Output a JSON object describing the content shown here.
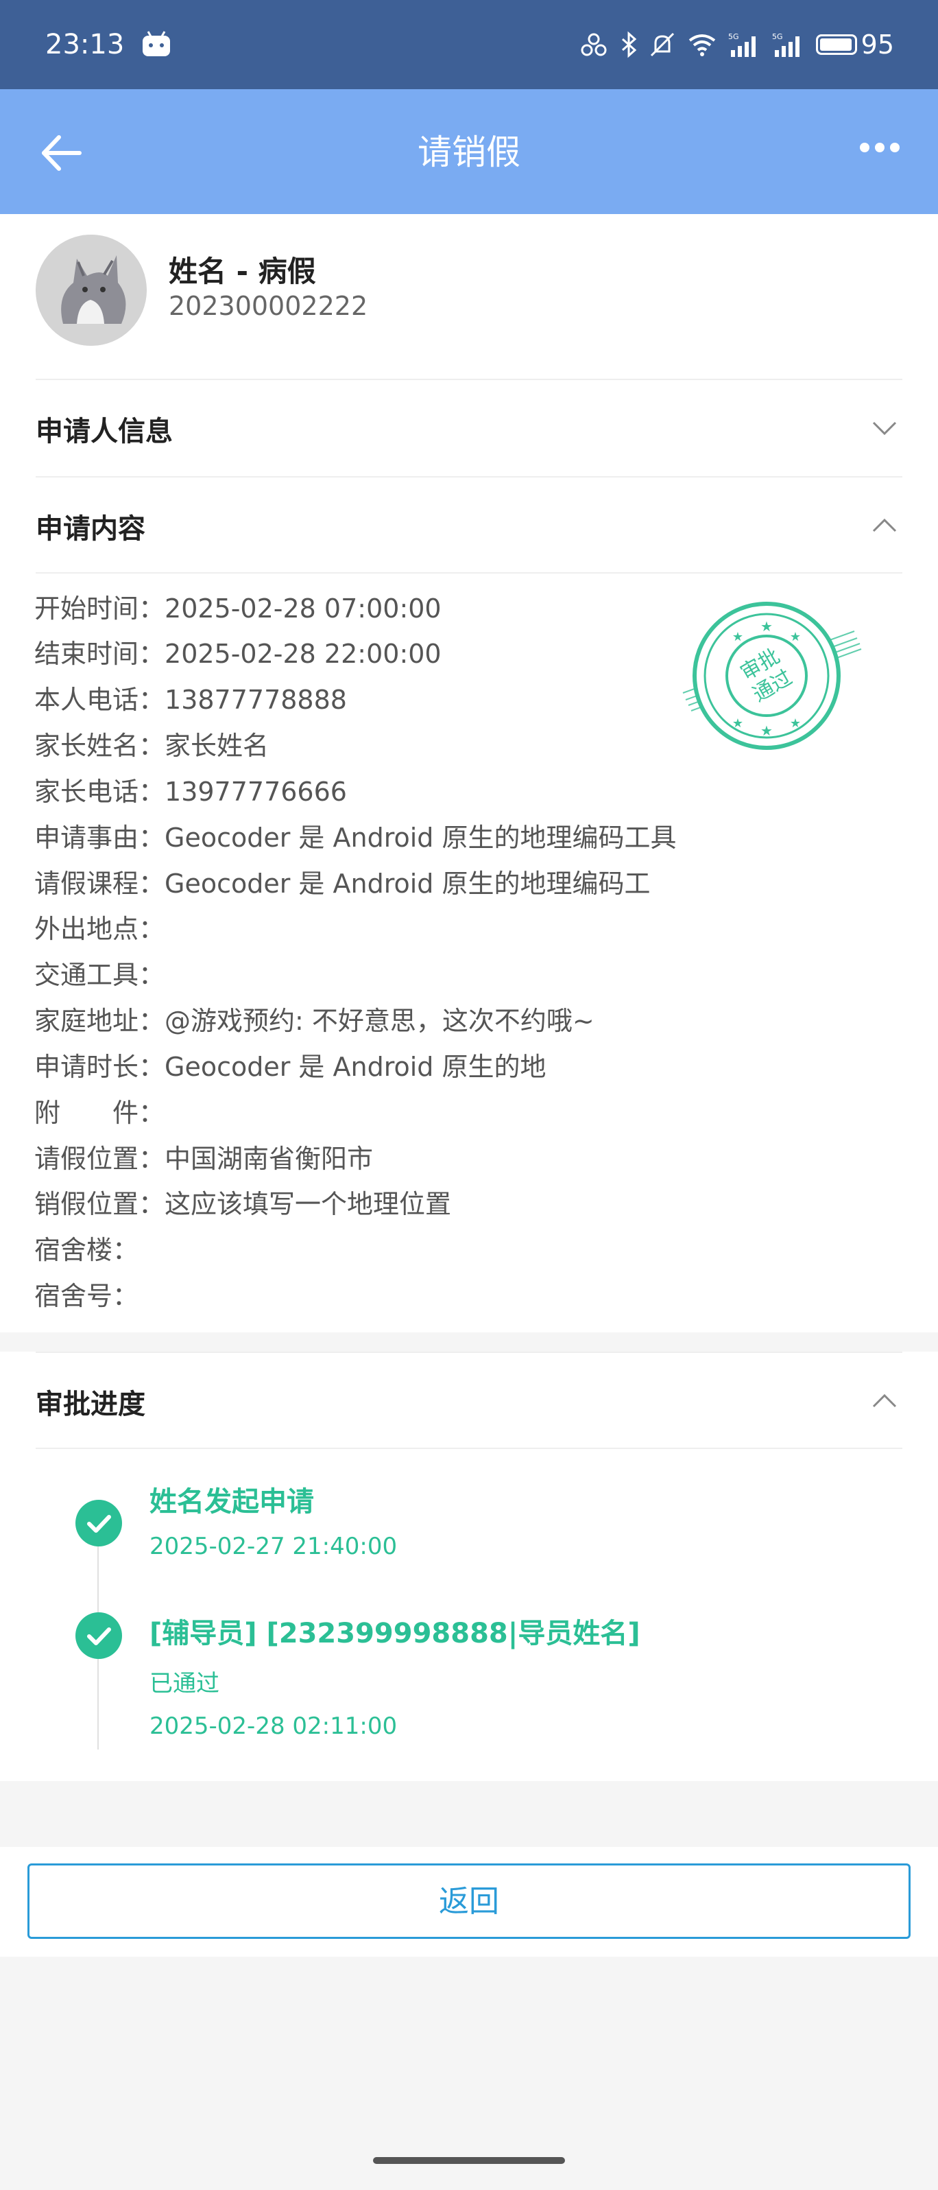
{
  "status_bar": {
    "time": "23:13",
    "battery": "95",
    "icons": [
      "android-icon",
      "link-icon",
      "bluetooth-icon",
      "mute-icon",
      "wifi-icon",
      "signal-5g-icon",
      "signal-5g-icon",
      "battery-icon"
    ],
    "background": "#3e6096"
  },
  "nav": {
    "title": "请销假",
    "background": "#7aabf2"
  },
  "profile": {
    "name": "姓名 - 病假",
    "id": "202300002222"
  },
  "sections": {
    "applicant": "申请人信息",
    "content": "申请内容",
    "progress": "审批进度"
  },
  "details": [
    {
      "label": "开始时间：",
      "value": "2025-02-28 07:00:00"
    },
    {
      "label": "结束时间：",
      "value": "2025-02-28 22:00:00"
    },
    {
      "label": "本人电话：",
      "value": "13877778888"
    },
    {
      "label": "家长姓名：",
      "value": "家长姓名"
    },
    {
      "label": "家长电话：",
      "value": "13977776666"
    },
    {
      "label": "申请事由：",
      "value": "Geocoder 是 Android 原生的地理编码工具"
    },
    {
      "label": "请假课程：",
      "value": "Geocoder 是 Android 原生的地理编码工"
    },
    {
      "label": "外出地点：",
      "value": ""
    },
    {
      "label": "交通工具：",
      "value": ""
    },
    {
      "label": "家庭地址：",
      "value": "@游戏预约: 不好意思，这次不约哦~"
    },
    {
      "label": "申请时长：",
      "value": "Geocoder 是 Android 原生的地"
    },
    {
      "label": "附　　件：",
      "value": ""
    },
    {
      "label": "请假位置：",
      "value": "中国湖南省衡阳市"
    },
    {
      "label": "销假位置：",
      "value": "这应该填写一个地理位置"
    },
    {
      "label": "宿舍楼：",
      "value": ""
    },
    {
      "label": "宿舍号：",
      "value": ""
    }
  ],
  "stamp": {
    "line1": "审批",
    "line2": "通过",
    "color": "#3cc39a"
  },
  "timeline": [
    {
      "title": "姓名发起申请",
      "status": "",
      "time": "2025-02-27 21:40:00"
    },
    {
      "title": "[辅导员] [232399998888|导员姓名]",
      "status": "已通过",
      "time": "2025-02-28 02:11:00"
    }
  ],
  "accent_color": "#2bbf95",
  "button": {
    "back_label": "返回",
    "color": "#2a9bd8"
  }
}
